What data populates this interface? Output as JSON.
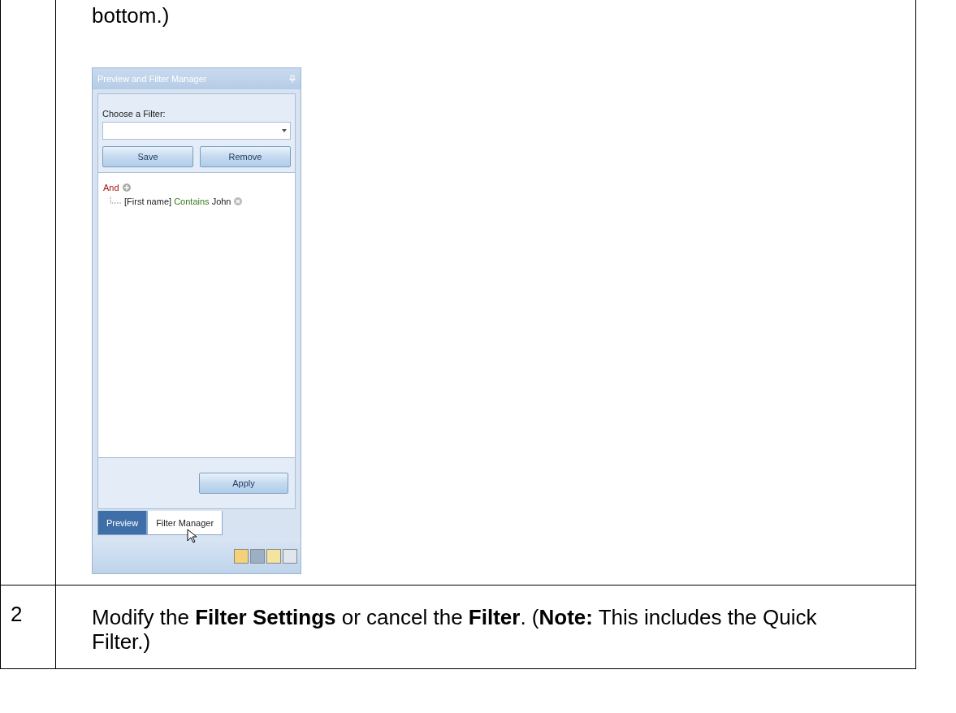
{
  "rows": [
    {
      "number": "",
      "text": "bottom.)",
      "panel": {
        "title": "Preview and Filter Manager",
        "filter_label": "Choose a Filter:",
        "buttons": [
          "Save",
          "Remove"
        ],
        "tree": [
          {
            "kind": "group",
            "label": "And",
            "children": [
              {
                "kind": "condition",
                "field": "[First name]",
                "operator": "Contains",
                "value": "John"
              }
            ]
          }
        ],
        "apply": "Apply",
        "tabs": [
          {
            "label": "Preview",
            "selected": false
          },
          {
            "label": "Filter Manager",
            "selected": true
          }
        ]
      }
    },
    {
      "number": "2",
      "text": "Modify the **Filter Settings** or cancel the **Filter**. (**Note:**  This includes the Quick Filter.)"
    }
  ]
}
